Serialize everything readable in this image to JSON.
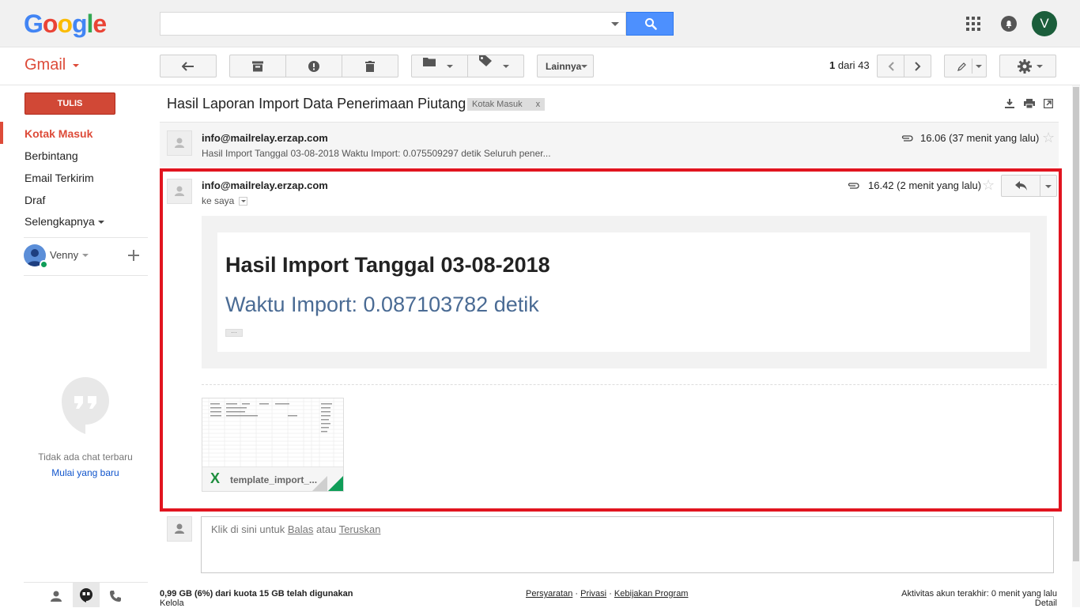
{
  "header": {
    "logo": [
      "G",
      "o",
      "o",
      "g",
      "l",
      "e"
    ],
    "logo_colors": [
      "#4285f4",
      "#ea4335",
      "#fbbc05",
      "#4285f4",
      "#34a853",
      "#ea4335"
    ],
    "search_placeholder": "",
    "avatar_initial": "V"
  },
  "toolbar": {
    "app_label": "Gmail",
    "more_label": "Lainnya",
    "page_current": "1",
    "page_rest": "dari 43"
  },
  "sidebar": {
    "compose_label": "TULIS",
    "items": [
      {
        "label": "Kotak Masuk",
        "active": true
      },
      {
        "label": "Berbintang",
        "active": false
      },
      {
        "label": "Email Terkirim",
        "active": false
      },
      {
        "label": "Draf",
        "active": false
      },
      {
        "label": "Selengkapnya",
        "active": false
      }
    ],
    "user_name": "Venny",
    "chat_empty": "Tidak ada chat terbaru",
    "chat_start": "Mulai yang baru"
  },
  "thread": {
    "subject": "Hasil Laporan Import Data Penerimaan Piutang",
    "label": "Kotak Masuk",
    "label_remove": "x",
    "messages": [
      {
        "sender": "info@mailrelay.erzap.com",
        "snippet": "Hasil Import Tanggal 03-08-2018 Waktu Import: 0.075509297 detik Seluruh pener...",
        "time": "16.06 (37 menit yang lalu)"
      },
      {
        "sender": "info@mailrelay.erzap.com",
        "to": "ke saya",
        "time": "16.42 (2 menit yang lalu)",
        "body_title": "Hasil Import Tanggal 03-08-2018",
        "body_subtitle": "Waktu Import: 0.087103782 detik",
        "ellipsis": "···",
        "attachment_name": "template_import_...",
        "attachment_type_icon": "X"
      }
    ],
    "reply_prefix": "Klik di sini untuk",
    "reply_link": "Balas",
    "reply_mid": "atau",
    "forward_link": "Teruskan"
  },
  "footer": {
    "quota": "0,99 GB (6%) dari kuota 15 GB telah digunakan",
    "manage": "Kelola",
    "terms": "Persyaratan",
    "privacy": "Privasi",
    "policy": "Kebijakan Program",
    "sep": "·",
    "activity": "Aktivitas akun terakhir: 0 menit yang lalu",
    "details": "Detail"
  },
  "colors": {
    "accent_red": "#dd4b39",
    "search_blue": "#4d90fe",
    "highlight_red": "#e1141f",
    "link_blue": "#1155cc"
  }
}
